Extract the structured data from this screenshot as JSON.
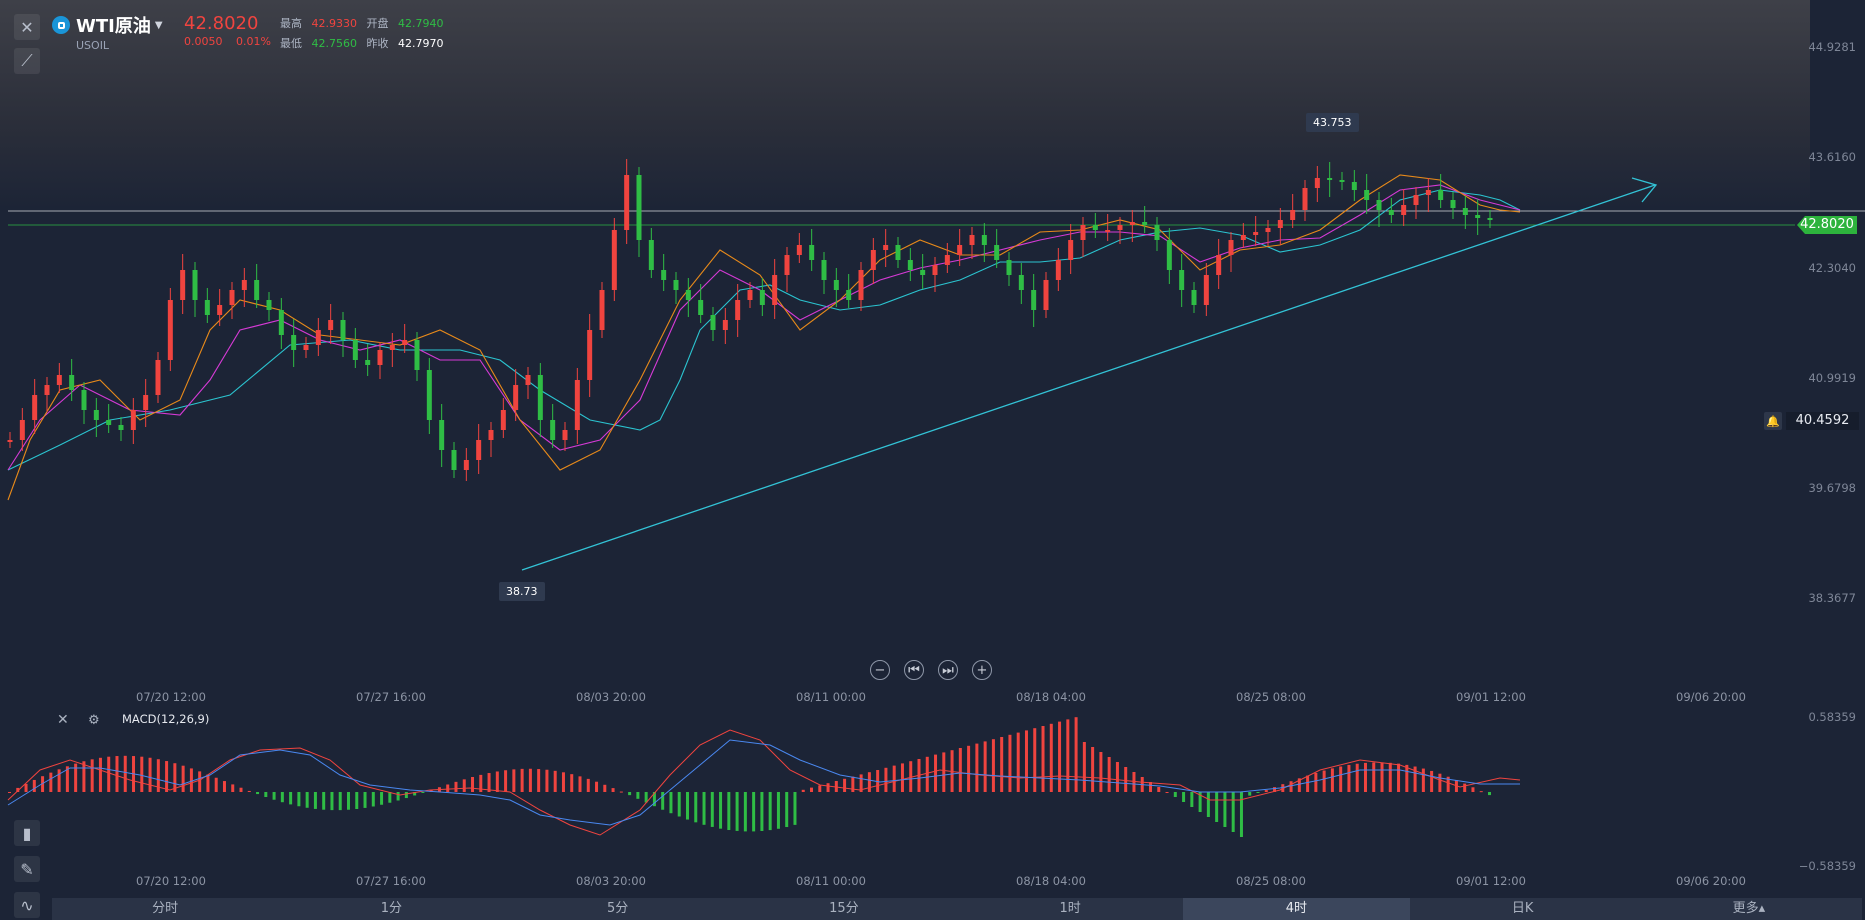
{
  "header": {
    "symbol_name": "WTI原油",
    "symbol_code": "USOIL",
    "price": "42.8020",
    "change": "0.0050",
    "change_pct": "0.01%",
    "high_label": "最高",
    "high": "42.9330",
    "open_label": "开盘",
    "open": "42.7940",
    "low_label": "最低",
    "low": "42.7560",
    "prev_label": "昨收",
    "prev_close": "42.7970"
  },
  "yaxis_main": [
    "44.9281",
    "43.6160",
    "42.3040",
    "40.9919",
    "39.6798",
    "38.3677"
  ],
  "yaxis_macd": [
    "0.58359",
    "−0.58359"
  ],
  "last_price": "42.8020",
  "alert_price": "40.4592",
  "annotations": {
    "high": "43.753",
    "low": "38.73"
  },
  "xaxis": [
    "07/20 12:00",
    "07/27 16:00",
    "08/03 20:00",
    "08/11 00:00",
    "08/18 04:00",
    "08/25 08:00",
    "09/01 12:00",
    "09/06 20:00"
  ],
  "macd": {
    "title": "MACD(12,26,9)"
  },
  "tabs": [
    {
      "label": "分时"
    },
    {
      "label": "1分"
    },
    {
      "label": "5分"
    },
    {
      "label": "15分"
    },
    {
      "label": "1时"
    },
    {
      "label": "4时",
      "active": true
    },
    {
      "label": "日K"
    },
    {
      "label": "更多▴"
    }
  ],
  "colors": {
    "up": "#f0443f",
    "down": "#2fbd45",
    "ma_orange": "#e88a1a",
    "ma_magenta": "#d63ad6",
    "ma_cyan": "#2bc4d0",
    "trend": "#33c3d6",
    "macd_red": "#f0443f",
    "macd_blue": "#4a88f0"
  }
}
